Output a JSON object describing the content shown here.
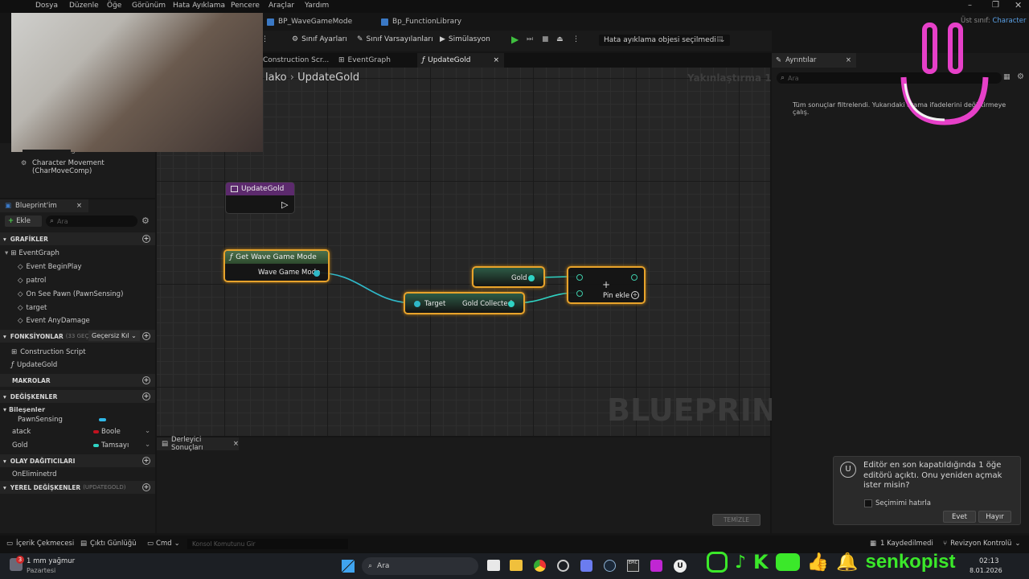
{
  "menu": {
    "items": [
      "Dosya",
      "Düzenle",
      "Öğe",
      "Görünüm",
      "Hata Ayıklama",
      "Pencere",
      "Araçlar",
      "Yardım"
    ]
  },
  "file_tabs": [
    "BP_WaveGameMode",
    "Bp_FunctionLibrary"
  ],
  "parent_class": {
    "label": "Üst sınıf:",
    "value": "Character"
  },
  "toolbar": {
    "class_settings": "Sınıf Ayarları",
    "class_defaults": "Sınıf Varsayılanları",
    "simulation": "Simülasyon",
    "debug_object": "Hata ayıklama objesi seçilmedi"
  },
  "graph_tabs": [
    "Construction Scr...",
    "EventGraph",
    "UpdateGold"
  ],
  "breadcrumb": {
    "parent": "lako",
    "current": "UpdateGold"
  },
  "zoom": "Yakınlaştırma 1:1",
  "watermark": "BLUEPRINT",
  "nodes": {
    "entry": {
      "title": "UpdateGold"
    },
    "get_mode": {
      "title": "Get Wave Game Mode",
      "output": "Wave Game Mode"
    },
    "gold_var": {
      "label": "Gold"
    },
    "gold_collected": {
      "input": "Target",
      "output": "Gold Collected"
    },
    "add": {
      "symbol": "+",
      "pin_add": "Pin ekle"
    }
  },
  "components": {
    "character_movement": "Character Movement (CharMoveComp)",
    "pawn_sensing_partial": "PawnSensing"
  },
  "my_blueprint": {
    "title": "Blueprint'im",
    "add": "Ekle",
    "search_placeholder": "Ara",
    "graphs_header": "GRAFİKLER",
    "event_graph": "EventGraph",
    "events": [
      "Event BeginPlay",
      "patrol",
      "On See Pawn (PawnSensing)",
      "target",
      "Event AnyDamage"
    ],
    "functions_header": "FONKSİYONLAR",
    "functions_count": "(33 GEÇERSİZ)",
    "override_label": "Geçersiz Kıl",
    "functions": [
      "Construction Script",
      "UpdateGold"
    ],
    "macros_header": "MAKROLAR",
    "variables_header": "DEĞİŞKENLER",
    "components_group": "Bileşenler",
    "pawn_sensing": "PawnSensing",
    "variables": [
      {
        "name": "atack",
        "type": "Boole",
        "color": "#c1121f"
      },
      {
        "name": "Gold",
        "type": "Tamsayı",
        "color": "#2fd3c3"
      }
    ],
    "dispatchers_header": "OLAY DAĞITICILARI",
    "dispatchers": [
      "OnEliminetrd"
    ],
    "locals_header": "YEREL DEĞİŞKENLER",
    "locals_context": "(UPDATEGOLD)"
  },
  "details": {
    "tab": "Ayrıntılar",
    "search_placeholder": "Ara",
    "message": "Tüm sonuçlar filtrelendi. Yukarıdaki arama ifadelerini değiştirmeye çalış."
  },
  "compiler": {
    "tab": "Derleyici Sonuçları",
    "clear": "TEMİZLE"
  },
  "notification": {
    "message": "Editör en son kapatıldığında 1 öğe editörü açıktı. Onu yeniden açmak ister misin?",
    "remember": "Seçimimi hatırla",
    "yes": "Evet",
    "no": "Hayır"
  },
  "statusbar": {
    "content_drawer": "İçerik Çekmecesi",
    "output_log": "Çıktı Günlüğü",
    "cmd": "Cmd",
    "console_placeholder": "Konsol Komutunu Gir",
    "unsaved": "1 Kaydedilmedi",
    "revision": "Revizyon Kontrolü"
  },
  "taskbar": {
    "weather": "1 mm yağmur",
    "day": "Pazartesi",
    "badge": "3",
    "search": "Ara",
    "time": "02:13",
    "date": "8.01.2026",
    "brand": "senkopist"
  },
  "colors": {
    "accent_orange": "#e8a32b",
    "int_pin": "#2fd3c3",
    "exec_pin": "#3ec9a8",
    "function_header": "#5c2a6d",
    "pure_header": "#3d6a3d",
    "overlay_pink": "#e640c8"
  }
}
